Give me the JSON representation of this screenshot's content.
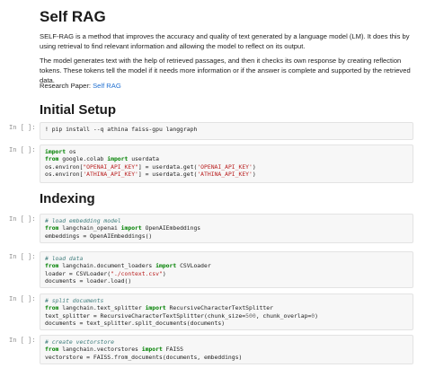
{
  "title": "Self RAG",
  "intro": {
    "p1": "SELF-RAG is a method that improves the accuracy and quality of text generated by a language model (LM). It does this by using retrieval to find relevant information and allowing the model to reflect on its output.",
    "p2": "The model generates text with the help of retrieved passages, and then it checks its own response by creating reflection tokens. These tokens tell the model if it needs more information or if the answer is complete and supported by the retrieved data.",
    "paper_label": "Research Paper: ",
    "paper_link": "Self RAG"
  },
  "sections": {
    "setup": "Initial Setup",
    "indexing": "Indexing"
  },
  "prompt": "In [ ]:",
  "cells": {
    "pip": {
      "l1": "! pip install --q athina faiss-gpu langgraph"
    },
    "env": {
      "l1_kw": "import",
      "l1_rest": " os",
      "l2_kw1": "from",
      "l2_mid": " google.colab ",
      "l2_kw2": "import",
      "l2_rest": " userdata",
      "l3_a": "os.environ[",
      "l3_s1": "\"OPENAI_API_KEY\"",
      "l3_b": "] = userdata.get(",
      "l3_s2": "'OPENAI_API_KEY'",
      "l3_c": ")",
      "l4_a": "os.environ[",
      "l4_s1": "'ATHINA_API_KEY'",
      "l4_b": "] = userdata.get(",
      "l4_s2": "'ATHINA_API_KEY'",
      "l4_c": ")"
    },
    "embed": {
      "comment": "# load embedding model",
      "l2_kw1": "from",
      "l2_mid": " langchain_openai ",
      "l2_kw2": "import",
      "l2_rest": " OpenAIEmbeddings",
      "l3": "embeddings = OpenAIEmbeddings()"
    },
    "load": {
      "comment": "# load data",
      "l2_kw1": "from",
      "l2_mid": " langchain.document_loaders ",
      "l2_kw2": "import",
      "l2_rest": " CSVLoader",
      "l3_a": "loader = CSVLoader(",
      "l3_s": "\"./context.csv\"",
      "l3_c": ")",
      "l4": "documents = loader.load()"
    },
    "split": {
      "comment": "# split documents",
      "l2_kw1": "from",
      "l2_mid": " langchain.text_splitter ",
      "l2_kw2": "import",
      "l2_rest": " RecursiveCharacterTextSplitter",
      "l3_a": "text_splitter = RecursiveCharacterTextSplitter(chunk_size=",
      "l3_n1": "500",
      "l3_b": ", chunk_overlap=",
      "l3_n2": "0",
      "l3_c": ")",
      "l4": "documents = text_splitter.split_documents(documents)"
    },
    "vector": {
      "comment": "# create vectorstore",
      "l2_kw1": "from",
      "l2_mid": " langchain.vectorstores ",
      "l2_kw2": "import",
      "l2_rest": " FAISS",
      "l3": "vectorstore = FAISS.from_documents(documents, embeddings)"
    }
  }
}
